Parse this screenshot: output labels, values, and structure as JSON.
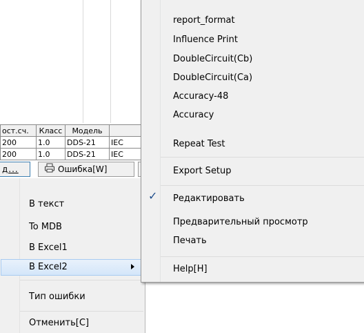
{
  "table": {
    "headers": [
      "ост.сч.",
      "Класс",
      "Модель",
      ""
    ],
    "rows": [
      [
        "200",
        "1.0",
        "DDS-21",
        "IEC"
      ],
      [
        "200",
        "1.0",
        "DDS-21",
        "IEC"
      ]
    ]
  },
  "toolbar": {
    "left_button_label": "д...",
    "error_button_label": "Ошибка[W]"
  },
  "left_menu": {
    "items": [
      "В текст",
      "To MDB",
      "B Excel1",
      "B Excel2",
      "Тип ошибки",
      "Отменить[C]"
    ],
    "highlighted": "B Excel2"
  },
  "right_menu": {
    "items": [
      "report_format",
      "Influence Print",
      "DoubleCircuit(Cb)",
      "DoubleCircuit(Ca)",
      "Accuracy-48",
      "Accuracy",
      "Repeat Test",
      "Export Setup",
      "Редактировать",
      "Предварительный просмотр",
      "Печать",
      "Help[H]"
    ],
    "checked": "Редактировать",
    "check_glyph": "✓"
  },
  "colors": {
    "menu_bg": "#f0f0f0",
    "highlight": "#d4e6fa",
    "check": "#1f4e8c"
  },
  "icons": {
    "printer": "printer-icon",
    "submenu": "chevron-right-icon",
    "check": "checkmark-icon"
  }
}
